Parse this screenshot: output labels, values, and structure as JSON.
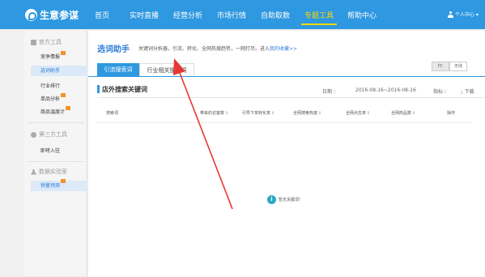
{
  "brand": {
    "name": "生意参谋"
  },
  "nav": {
    "items": [
      {
        "label": "首页"
      },
      {
        "label": "实时直播"
      },
      {
        "label": "经营分析"
      },
      {
        "label": "市场行情"
      },
      {
        "label": "自助取数"
      },
      {
        "label": "专题工具"
      },
      {
        "label": "帮助中心"
      }
    ],
    "active_label": "专题工具",
    "user_label": "个人中心 ▾"
  },
  "sidebar": {
    "groups": [
      {
        "label": "官方工具"
      },
      {
        "label": "第三方工具"
      },
      {
        "label": "数据实验室"
      }
    ],
    "items": [
      {
        "label": "竞争情报"
      },
      {
        "label": "选词助手"
      },
      {
        "label": "行业排行"
      },
      {
        "label": "单品分析"
      },
      {
        "label": "商品温度计"
      },
      {
        "label": "即将入驻"
      },
      {
        "label": "销量预测"
      }
    ]
  },
  "page": {
    "title": "选词助手",
    "desc_text": "关键词分析器，引流、转化、全网热搜趋势，一网打尽。进入",
    "desc_link": "我的收藏>>"
  },
  "tabs": [
    {
      "label": "引流搜索词"
    },
    {
      "label": "行业相关搜索词"
    }
  ],
  "device_toggle": {
    "pc": "PC",
    "wireless": "无线"
  },
  "section": {
    "title": "店外搜索关键词",
    "filters": {
      "period_label": "日期",
      "date_range": "2016-08-16~2016-08-16",
      "metric_label": "指标",
      "download_label": "下载"
    }
  },
  "table": {
    "headers": [
      {
        "label": "搜索词"
      },
      {
        "label": "带来的访客数"
      },
      {
        "label": "引导下单转化率"
      },
      {
        "label": "全网搜索热度"
      },
      {
        "label": "全网点击率"
      },
      {
        "label": "全网商品数"
      },
      {
        "label": "操作"
      }
    ],
    "empty_text": "暂无关键词!"
  },
  "colors": {
    "header_bg": "#2e98e0",
    "accent": "#2e7ed6",
    "active_nav": "#ffd700",
    "badge": "#f0932b",
    "annotation_arrow": "#e53935"
  }
}
